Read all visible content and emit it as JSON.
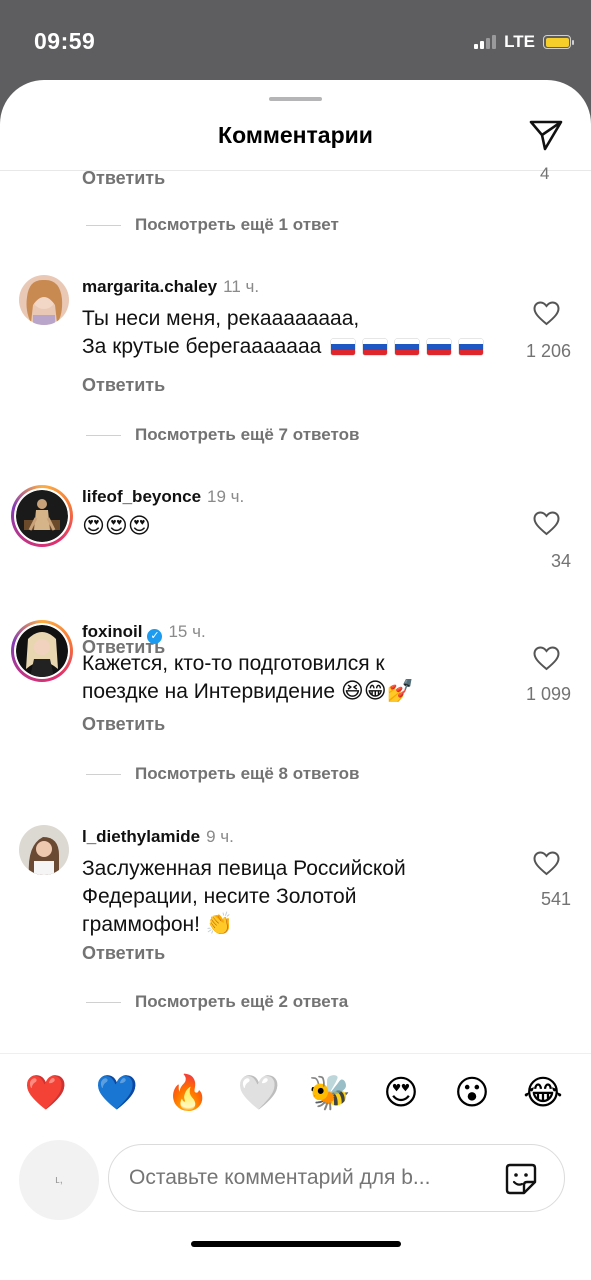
{
  "status_bar": {
    "time": "09:59",
    "network": "LTE"
  },
  "sheet": {
    "title": "Комментарии"
  },
  "top_partial": {
    "reply_label": "Ответить",
    "likes": "4"
  },
  "view_replies": [
    {
      "label": "Посмотреть ещё 1 ответ"
    },
    {
      "label": "Посмотреть ещё 7 ответов"
    },
    {
      "label": "Посмотреть ещё 8 ответов"
    },
    {
      "label": "Посмотреть ещё 2 ответа"
    }
  ],
  "comments": [
    {
      "username": "margarita.chaley",
      "time": "11 ч.",
      "lines": [
        "Ты неси меня, рекаааааааа,",
        "За крутые берегааааааа"
      ],
      "emoji_flags": 5,
      "likes": "1 206",
      "reply_label": "Ответить"
    },
    {
      "username": "lifeof_beyonce",
      "time": "19 ч.",
      "emoji_text": "😍😍😍",
      "likes": "34",
      "reply_label": "Ответить"
    },
    {
      "username": "foxinoil",
      "verified": true,
      "time": "15 ч.",
      "lines": [
        "Кажется, кто-то подготовился к",
        "поездке на Интервидение"
      ],
      "trailing_emoji": "😆😁💅",
      "likes": "1 099",
      "reply_label": "Ответить"
    },
    {
      "username": "l_diethylamide",
      "time": "9 ч.",
      "lines": [
        "Заслуженная певица Российской",
        "Федерации, несите Золотой",
        "граммофон!"
      ],
      "trailing_emoji": "👏",
      "likes": "541",
      "reply_label": "Ответить"
    }
  ],
  "reactions": [
    "❤️",
    "💙",
    "🔥",
    "🤍",
    "🐝",
    "😍",
    "😮",
    "😂"
  ],
  "composer": {
    "placeholder": "Оставьте комментарий для b..."
  },
  "colors": {
    "accent_verified": "#1d9bf0",
    "secondary_text": "#737373",
    "battery": "#f6cf2a"
  }
}
